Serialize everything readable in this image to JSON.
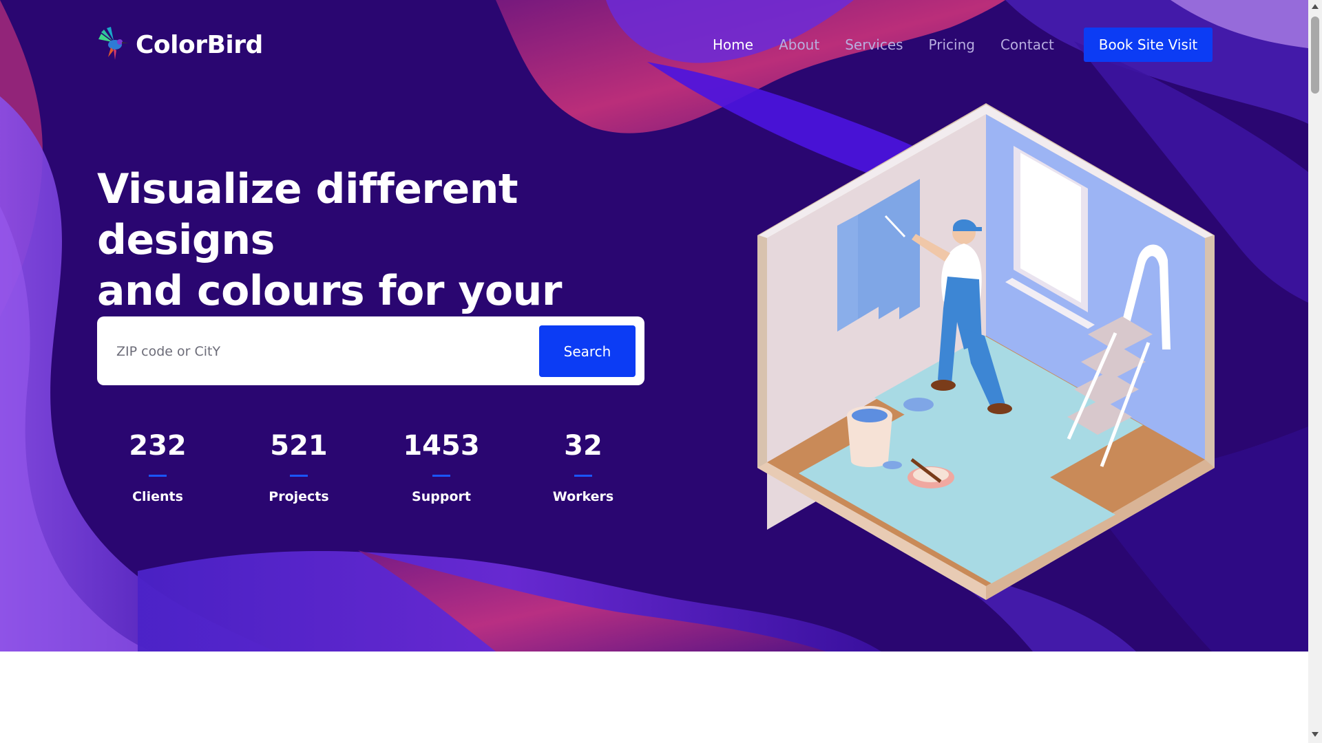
{
  "brand": {
    "name": "ColorBird",
    "logo_icon": "hummingbird-icon"
  },
  "nav": {
    "items": [
      {
        "label": "Home",
        "active": true
      },
      {
        "label": "About",
        "active": false
      },
      {
        "label": "Services",
        "active": false
      },
      {
        "label": "Pricing",
        "active": false
      },
      {
        "label": "Contact",
        "active": false
      }
    ],
    "cta_label": "Book Site Visit"
  },
  "hero": {
    "headline_line1": "Visualize different designs",
    "headline_line2": "and colours for your home",
    "illustration": "painter-room-illustration"
  },
  "search": {
    "placeholder": "ZIP code or CitY",
    "value": "",
    "button_label": "Search"
  },
  "stats": [
    {
      "value": "232",
      "label": "Clients"
    },
    {
      "value": "521",
      "label": "Projects"
    },
    {
      "value": "1453",
      "label": "Support"
    },
    {
      "value": "32",
      "label": "Workers"
    }
  ],
  "colors": {
    "hero_background": "#2a0671",
    "accent_blue": "#0c3cf4",
    "wave_magenta": "#b0266e",
    "wave_violet": "#4a1fd0",
    "nav_inactive": "#b8aee0"
  }
}
